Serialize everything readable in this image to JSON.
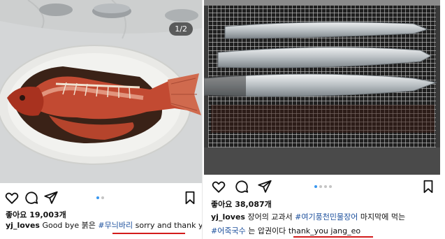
{
  "left_post": {
    "counter": "1/2",
    "likes": "좋아요 19,003개",
    "username": "yj_loves",
    "caption_text": "Good bye 붉은",
    "hashtag": "#무늬바리",
    "highlight": "sorry and thank you",
    "image_desc": "braised-red-fish-plate"
  },
  "right_post": {
    "likes": "좋아요 38,087개",
    "username": "yj_loves",
    "caption_text": "장어의 교과서",
    "hashtag1": "#여기풍천민물장어",
    "caption_text2": "마지막에 먹는",
    "hashtag2": "#어죽국수",
    "caption_text3": "는 압권이다",
    "highlight": "thank_you jang_eo",
    "image_desc": "grilled-eels-on-grill"
  },
  "colors": {
    "hashtag": "#1b4f9c",
    "underline": "#d31b1b",
    "active_dot": "#3897f0"
  },
  "icons": [
    "heart-icon",
    "comment-icon",
    "share-icon",
    "bookmark-icon"
  ]
}
